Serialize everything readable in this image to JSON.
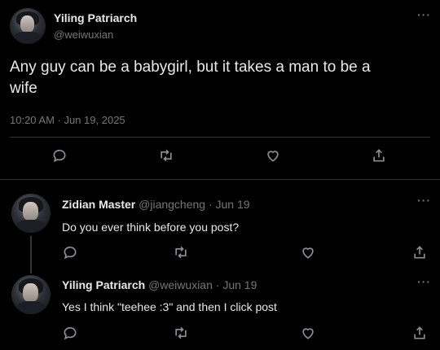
{
  "main_tweet": {
    "display_name": "Yiling Patriarch",
    "handle": "@weiwuxian",
    "more_label": "···",
    "text_line1": "Any guy can be a babygirl, but it takes a man to be a",
    "text_line2": "wife",
    "timestamp": "10:20 AM · Jun 19, 2025",
    "actions": [
      "reply-icon",
      "retweet-icon",
      "like-icon",
      "share-icon"
    ]
  },
  "replies": [
    {
      "display_name": "Zidian Master",
      "handle": "@jiangcheng",
      "date": "· Jun 19",
      "more_label": "···",
      "text": "Do you ever think before you post?"
    },
    {
      "display_name": "Yiling Patriarch",
      "handle": "@weiwuxian",
      "date": "· Jun 19",
      "more_label": "···",
      "text": "Yes I think \"teehee :3\" and then I click post"
    }
  ],
  "colors": {
    "background": "#000000",
    "text": "#e7e9ea",
    "muted": "#71767b",
    "divider": "#2f3336"
  }
}
